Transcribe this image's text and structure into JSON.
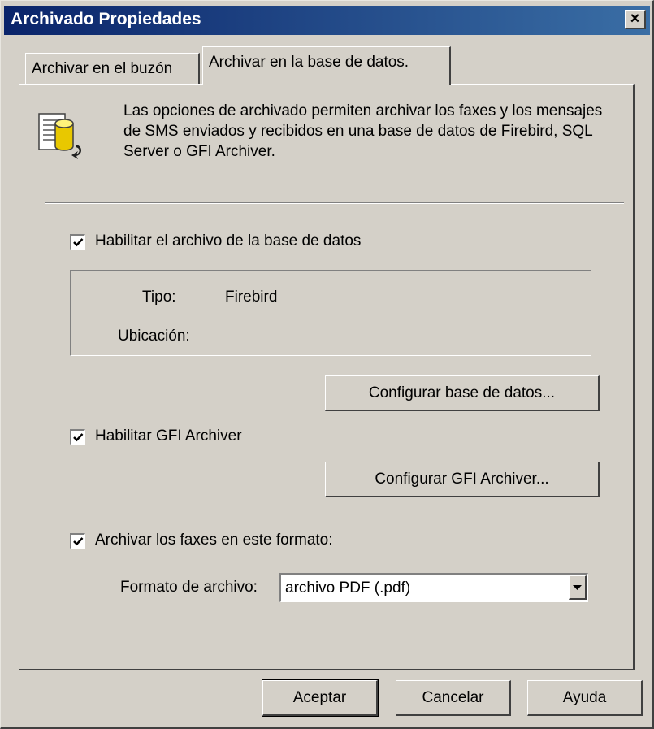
{
  "window": {
    "title": "Archivado Propiedades",
    "close_glyph": "×"
  },
  "tabs": [
    {
      "label": "Archivar en el buzón",
      "active": false
    },
    {
      "label": "Archivar en la base de datos.",
      "active": true
    }
  ],
  "panel": {
    "description": "Las opciones de archivado permiten archivar los faxes y los mensajes de SMS enviados y recibidos en una base de datos de Firebird, SQL Server o GFI Archiver.",
    "icon": "database-document-icon",
    "enable_db": {
      "label": "Habilitar el archivo de la base de datos",
      "checked": true
    },
    "db_info": {
      "type_label": "Tipo:",
      "type_value": "Firebird",
      "location_label": "Ubicación:",
      "location_value": ""
    },
    "configure_db_button": "Configurar base de datos...",
    "enable_gfi": {
      "label": "Habilitar GFI Archiver",
      "checked": true
    },
    "configure_gfi_button": "Configurar GFI Archiver...",
    "archive_format": {
      "label": "Archivar los faxes en este formato:",
      "checked": true
    },
    "file_format": {
      "label": "Formato de archivo:",
      "value": "archivo PDF (.pdf)"
    }
  },
  "footer": {
    "ok": "Aceptar",
    "cancel": "Cancelar",
    "help": "Ayuda"
  },
  "colors": {
    "face": "#d4d0c8",
    "title_start": "#0a246a",
    "title_end": "#3a6ea5"
  }
}
